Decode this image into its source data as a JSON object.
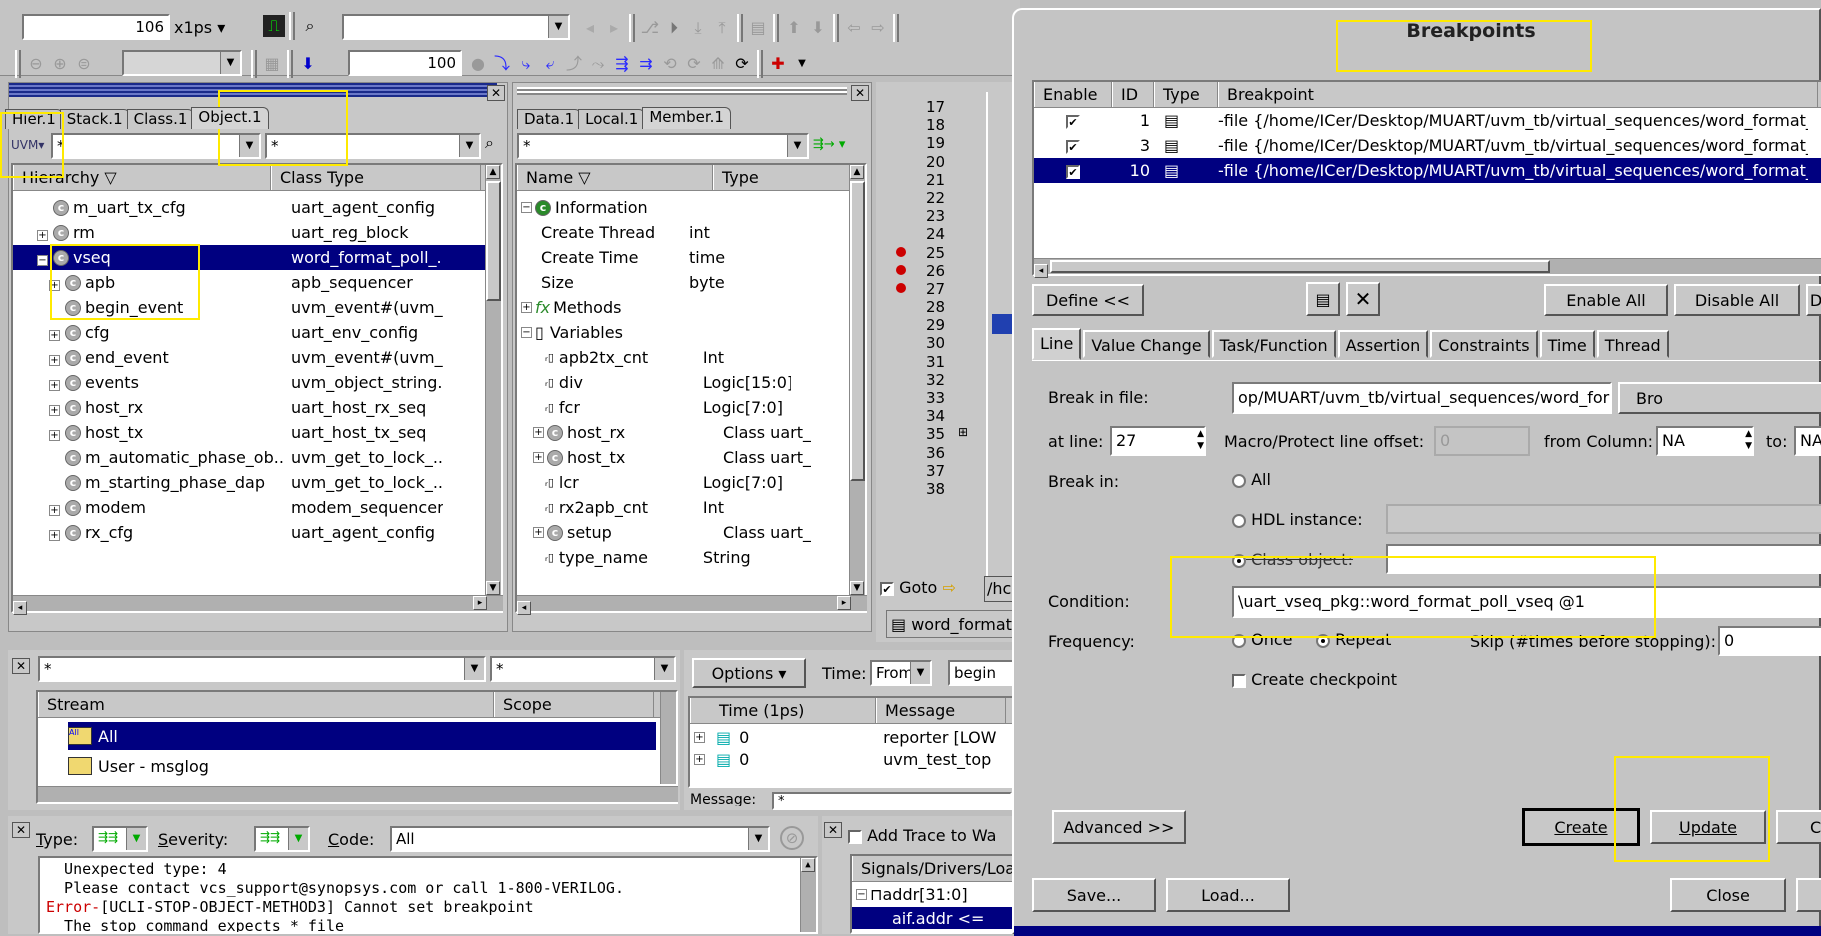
{
  "toolbar": {
    "time_value": "106",
    "time_unit": "x1ps",
    "step_value": "100"
  },
  "hier_panel": {
    "tabs": [
      "Hier.1",
      "Stack.1",
      "Class.1",
      "Object.1"
    ],
    "filter1": "*",
    "filter2": "*",
    "columns": [
      "Hierarchy",
      "Class Type"
    ],
    "rows": [
      {
        "name": "m_uart_tx_cfg",
        "type": "uart_agent_config",
        "exp": false
      },
      {
        "name": "rm",
        "type": "uart_reg_block",
        "exp": true
      },
      {
        "name": "vseq",
        "type": "word_format_poll_...",
        "exp": true,
        "sel": true
      },
      {
        "name": "apb",
        "type": "apb_sequencer",
        "exp": true
      },
      {
        "name": "begin_event",
        "type": "uvm_event#(uvm_...",
        "exp": false
      },
      {
        "name": "cfg",
        "type": "uart_env_config",
        "exp": true
      },
      {
        "name": "end_event",
        "type": "uvm_event#(uvm_...",
        "exp": true
      },
      {
        "name": "events",
        "type": "uvm_object_string...",
        "exp": true
      },
      {
        "name": "host_rx",
        "type": "uart_host_rx_seq",
        "exp": true
      },
      {
        "name": "host_tx",
        "type": "uart_host_tx_seq",
        "exp": true
      },
      {
        "name": "m_automatic_phase_ob...",
        "type": "uvm_get_to_lock_...",
        "exp": false
      },
      {
        "name": "m_starting_phase_dap",
        "type": "uvm_get_to_lock_...",
        "exp": false
      },
      {
        "name": "modem",
        "type": "modem_sequencer",
        "exp": true
      },
      {
        "name": "rx_cfg",
        "type": "uart_agent_config",
        "exp": true
      }
    ]
  },
  "data_panel": {
    "tabs": [
      "Data.1",
      "Local.1",
      "Member.1"
    ],
    "filter": "*",
    "columns": [
      "Name",
      "Type"
    ],
    "rows": [
      {
        "name": "Information",
        "type": "",
        "icon": "info"
      },
      {
        "name": "Create Thread",
        "type": "int",
        "icon": "none"
      },
      {
        "name": "Create Time",
        "type": "time",
        "icon": "none"
      },
      {
        "name": "Size",
        "type": "byte",
        "icon": "none"
      },
      {
        "name": "Methods",
        "type": "",
        "icon": "fx"
      },
      {
        "name": "Variables",
        "type": "",
        "icon": "var"
      },
      {
        "name": "apb2tx_cnt",
        "type": "Int",
        "icon": "r"
      },
      {
        "name": "div",
        "type": "Logic[15:0]",
        "icon": "r"
      },
      {
        "name": "fcr",
        "type": "Logic[7:0]",
        "icon": "r"
      },
      {
        "name": "host_rx",
        "type": "Class uart_host",
        "icon": "c"
      },
      {
        "name": "host_tx",
        "type": "Class uart_host",
        "icon": "c"
      },
      {
        "name": "lcr",
        "type": "Logic[7:0]",
        "icon": "r"
      },
      {
        "name": "rx2apb_cnt",
        "type": "Int",
        "icon": "r"
      },
      {
        "name": "setup",
        "type": "Class uart_con",
        "icon": "c"
      },
      {
        "name": "type_name",
        "type": "String",
        "icon": "r"
      }
    ]
  },
  "source": {
    "lines": [
      "17",
      "18",
      "19",
      "20",
      "21",
      "22",
      "23",
      "24",
      "25",
      "26",
      "27",
      "28",
      "29",
      "30",
      "31",
      "32",
      "33",
      "34",
      "35",
      "36",
      "37",
      "38"
    ],
    "goto_label": "Goto",
    "path_frag": "/hc",
    "file_tab": "word_format"
  },
  "stream_panel": {
    "filter1": "*",
    "filter2": "*",
    "columns": [
      "Stream",
      "Scope"
    ],
    "rows": [
      "All",
      "User - msglog"
    ]
  },
  "msg_panel": {
    "options": "Options",
    "time_label": "Time:",
    "from": "From",
    "begin": "begin",
    "columns": [
      "Time (1ps)",
      "Message"
    ],
    "rows": [
      {
        "t": "0",
        "m": "reporter [LOW"
      },
      {
        "t": "0",
        "m": "uvm_test_top"
      }
    ],
    "message_label": "Message:",
    "message_value": "*"
  },
  "console": {
    "type_label": "Type:",
    "severity_label": "Severity:",
    "code_label": "Code:",
    "code_value": "All",
    "lines": [
      {
        "t": "  Unexpected type: 4",
        "err": false
      },
      {
        "t": "  Please contact vcs_support@synopsys.com or call 1-800-VERILOG.",
        "err": false
      },
      {
        "t": "Error-",
        "rest": "[UCLI-STOP-OBJECT-METHOD3] Cannot set breakpoint",
        "err": true
      },
      {
        "t": "  The stop command expects * file",
        "err": false
      }
    ]
  },
  "trace": {
    "add_trace": "Add Trace to Wa",
    "columns": "Signals/Drivers/Loa",
    "rows": [
      "addr[31:0]",
      "aif.addr <= "
    ]
  },
  "dialog": {
    "title": "Breakpoints",
    "bp_columns": [
      "Enable",
      "ID",
      "Type",
      "Breakpoint"
    ],
    "bps": [
      {
        "id": "1",
        "path": "-file {/home/ICer/Desktop/MUART/uvm_tb/virtual_sequences/word_format_p"
      },
      {
        "id": "3",
        "path": "-file {/home/ICer/Desktop/MUART/uvm_tb/virtual_sequences/word_format_p"
      },
      {
        "id": "10",
        "path": "-file {/home/ICer/Desktop/MUART/uvm_tb/virtual_sequences/word_format_p"
      }
    ],
    "define_btn": "Define <<",
    "enable_all": "Enable All",
    "disable_all": "Disable All",
    "d_btn": "D",
    "tabs": [
      "Line",
      "Value Change",
      "Task/Function",
      "Assertion",
      "Constraints",
      "Time",
      "Thread"
    ],
    "break_file_label": "Break in file:",
    "break_file_value": "op/MUART/uvm_tb/virtual_sequences/word_format_poll_vseq.svh",
    "browse_btn": "Bro",
    "at_line_label": "at line:",
    "at_line_value": "27",
    "macro_label": "Macro/Protect line offset:",
    "macro_value": "0",
    "from_col_label": "from Column:",
    "from_col_value": "NA",
    "to_label": "to:",
    "to_value": "NA",
    "break_in_label": "Break in:",
    "opt_all": "All",
    "opt_hdl": "HDL instance:",
    "opt_class": "Class object:",
    "condition_label": "Condition:",
    "condition_value": "\\uart_vseq_pkg::word_format_poll_vseq @1",
    "frequency_label": "Frequency:",
    "once": "Once",
    "repeat": "Repeat",
    "skip_label": "Skip (#times before stopping):",
    "skip_value": "0",
    "checkpoint": "Create checkpoint",
    "advanced": "Advanced >>",
    "create": "Create",
    "update": "Update",
    "c_btn": "C",
    "save": "Save...",
    "load": "Load...",
    "close": "Close"
  }
}
